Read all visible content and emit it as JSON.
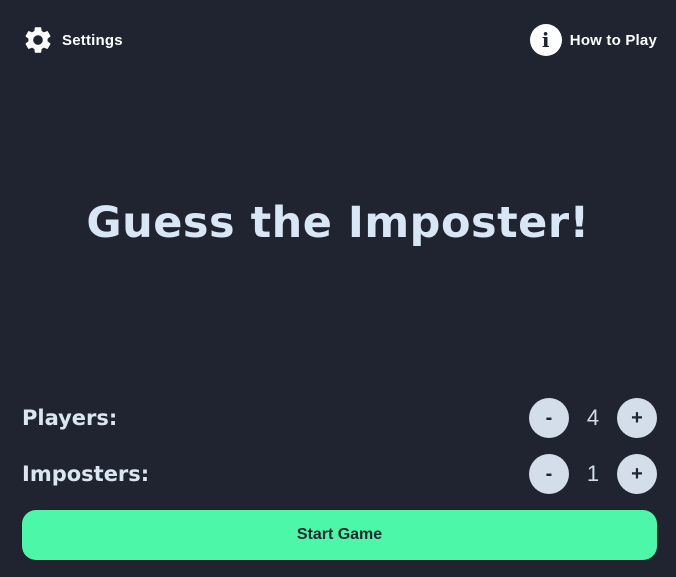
{
  "header": {
    "settings_label": "Settings",
    "settings_icon": "gear-icon",
    "help_label": "How to Play",
    "help_icon": "info-icon"
  },
  "main": {
    "title": "Guess the Imposter!"
  },
  "counters": {
    "players": {
      "label": "Players:",
      "value": "4",
      "decrement": "-",
      "increment": "+"
    },
    "imposters": {
      "label": "Imposters:",
      "value": "1",
      "decrement": "-",
      "increment": "+"
    }
  },
  "actions": {
    "start_label": "Start Game"
  },
  "colors": {
    "background": "#1f2430",
    "accent": "#4cf7a8",
    "text": "#dbe6f2"
  }
}
